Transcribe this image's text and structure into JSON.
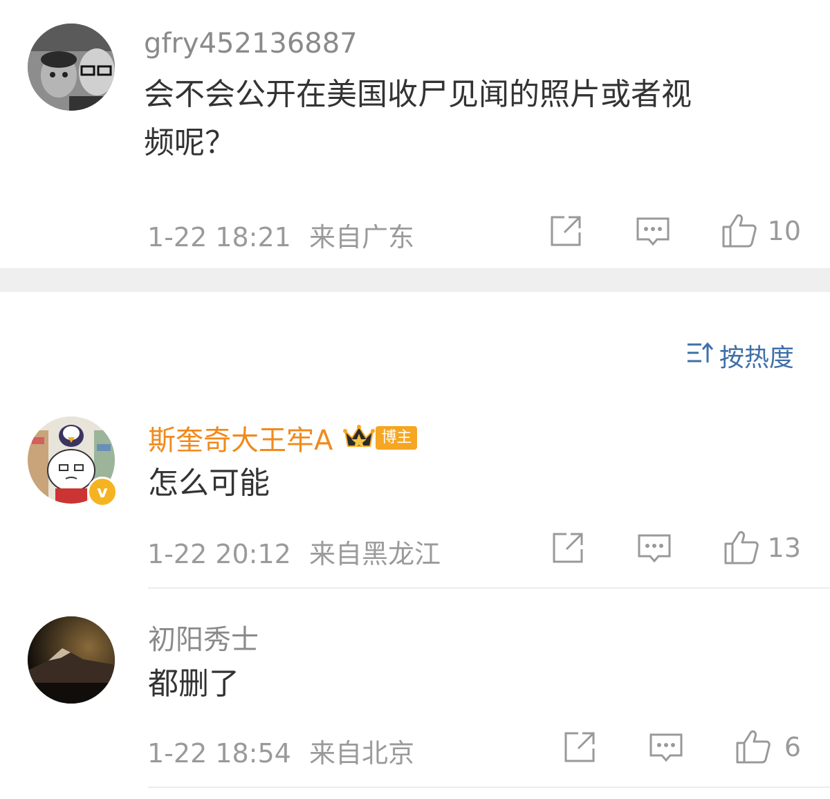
{
  "comments": [
    {
      "username": "gfry452136887",
      "content_lines": [
        "会不会公开在美国收尸见闻的照片或者视",
        "频呢？"
      ],
      "time": "1-22 18:21",
      "location": "来自广东",
      "like_count": "10",
      "icons": [
        "share-icon",
        "comment-icon",
        "like-icon"
      ]
    },
    {
      "username": "斯奎奇大王牢A",
      "badge": "博主",
      "content": "怎么可能",
      "time": "1-22 20:12",
      "location": "来自黑龙江",
      "like_count": "13",
      "icons": [
        "crown-icon",
        "verified-icon",
        "share-icon",
        "comment-icon",
        "like-icon"
      ]
    },
    {
      "username": "初阳秀士",
      "content": "都删了",
      "time": "1-22 18:54",
      "location": "来自北京",
      "like_count": "6",
      "icons": [
        "share-icon",
        "comment-icon",
        "like-icon"
      ]
    }
  ],
  "sort": {
    "label": "按热度",
    "icon": "sort-icon"
  },
  "colors": {
    "accent": "#3e6fa8",
    "blogger_name": "#f08a1c",
    "badge": "#f5a623"
  }
}
